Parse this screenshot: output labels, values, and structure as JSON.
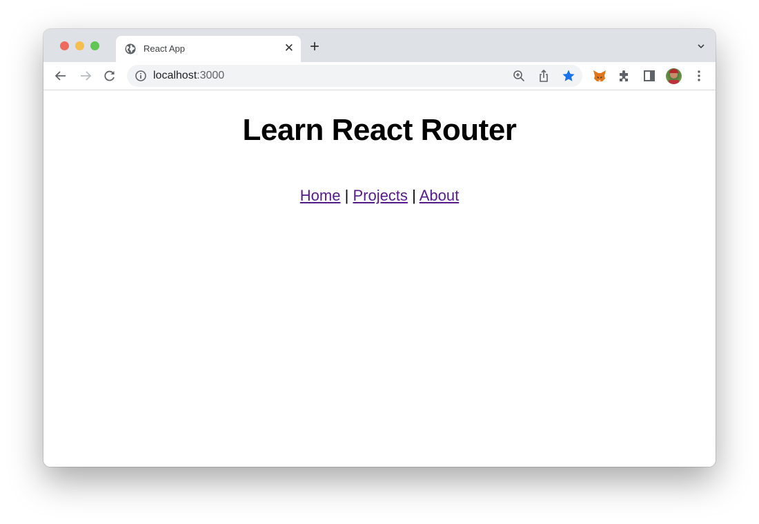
{
  "browser": {
    "tab_title": "React App",
    "tab_icon": "globe-icon",
    "url_host": "localhost",
    "url_port": ":3000",
    "bookmark_star_color": "#1a73e8",
    "extensions": [
      "metamask-fox-icon",
      "puzzle-extensions-icon",
      "side-panel-icon",
      "profile-avatar",
      "kebab-menu-icon"
    ]
  },
  "page": {
    "heading": "Learn React Router",
    "nav": {
      "links": [
        "Home",
        "Projects",
        "About"
      ],
      "separator": "|",
      "link_color": "#551a8b"
    }
  }
}
